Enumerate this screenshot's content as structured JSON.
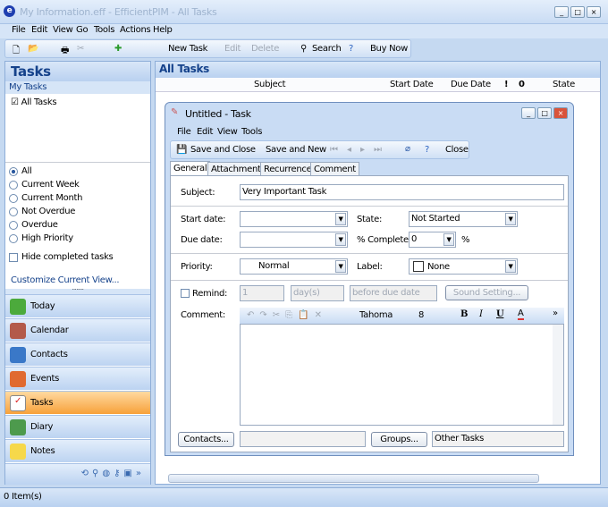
{
  "window": {
    "title": "My Information.eff - EfficientPIM - All Tasks"
  },
  "menu": [
    "File",
    "Edit",
    "View",
    "Go",
    "Tools",
    "Actions",
    "Help"
  ],
  "toolbar": {
    "new_task": "New Task",
    "edit": "Edit",
    "delete": "Delete",
    "search": "Search",
    "buy_now": "Buy Now"
  },
  "sidebar": {
    "title": "Tasks",
    "section": "My Tasks",
    "list": [
      "All Tasks"
    ],
    "filters": [
      "All",
      "Current Week",
      "Current Month",
      "Not Overdue",
      "Overdue",
      "High Priority"
    ],
    "selected_filter": "All",
    "hide_completed": "Hide completed tasks",
    "customize": "Customize Current View...",
    "nav": [
      "Today",
      "Calendar",
      "Contacts",
      "Events",
      "Tasks",
      "Diary",
      "Notes"
    ],
    "selected_nav": "Tasks"
  },
  "main": {
    "title": "All Tasks",
    "columns": [
      "Subject",
      "Start Date",
      "Due Date",
      "!",
      "0",
      "State"
    ]
  },
  "status": {
    "items": "0 Item(s)"
  },
  "dialog": {
    "title": "Untitled - Task",
    "menu": [
      "File",
      "Edit",
      "View",
      "Tools"
    ],
    "toolbar": {
      "save_close": "Save and Close",
      "save_new": "Save and New",
      "close": "Close"
    },
    "tabs": [
      "General",
      "Attachments",
      "Recurrence",
      "Comment"
    ],
    "subject_label": "Subject:",
    "subject": "Very Important Task",
    "start_label": "Start date:",
    "start": "",
    "due_label": "Due date:",
    "due": "",
    "state_label": "State:",
    "state": "Not Started",
    "complete_label": "% Complete:",
    "complete": "0",
    "pct": "%",
    "priority_label": "Priority:",
    "priority": "Normal",
    "label_label": "Label:",
    "label": "None",
    "remind_label": "Remind:",
    "remind_num": "1",
    "remind_unit": "day(s)",
    "remind_when": "before due date",
    "sound": "Sound Setting...",
    "comment_label": "Comment:",
    "font": "Tahoma",
    "font_size": "8",
    "contacts_btn": "Contacts...",
    "contacts": "",
    "groups_btn": "Groups...",
    "groups": "Other Tasks"
  }
}
